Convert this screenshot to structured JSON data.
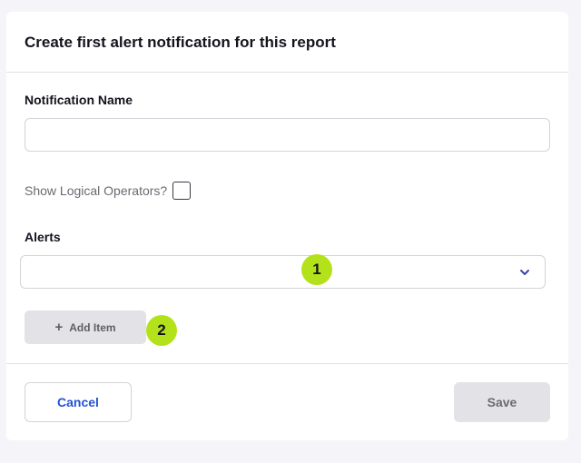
{
  "dialog": {
    "title": "Create first alert notification for this report"
  },
  "form": {
    "notification_name": {
      "label": "Notification Name",
      "value": "",
      "placeholder": ""
    },
    "logical_operators": {
      "label": "Show Logical Operators?",
      "checked": false
    },
    "alerts": {
      "label": "Alerts",
      "selected": "",
      "icon": "chevron-down-icon"
    },
    "add_item": {
      "label": "Add Item",
      "icon": "plus-icon"
    }
  },
  "annotations": {
    "badge_1": "1",
    "badge_2": "2"
  },
  "footer": {
    "cancel_label": "Cancel",
    "save_label": "Save"
  },
  "colors": {
    "accent": "#2352d4",
    "badge": "#b3e21a",
    "chevron": "#3a45a8"
  }
}
